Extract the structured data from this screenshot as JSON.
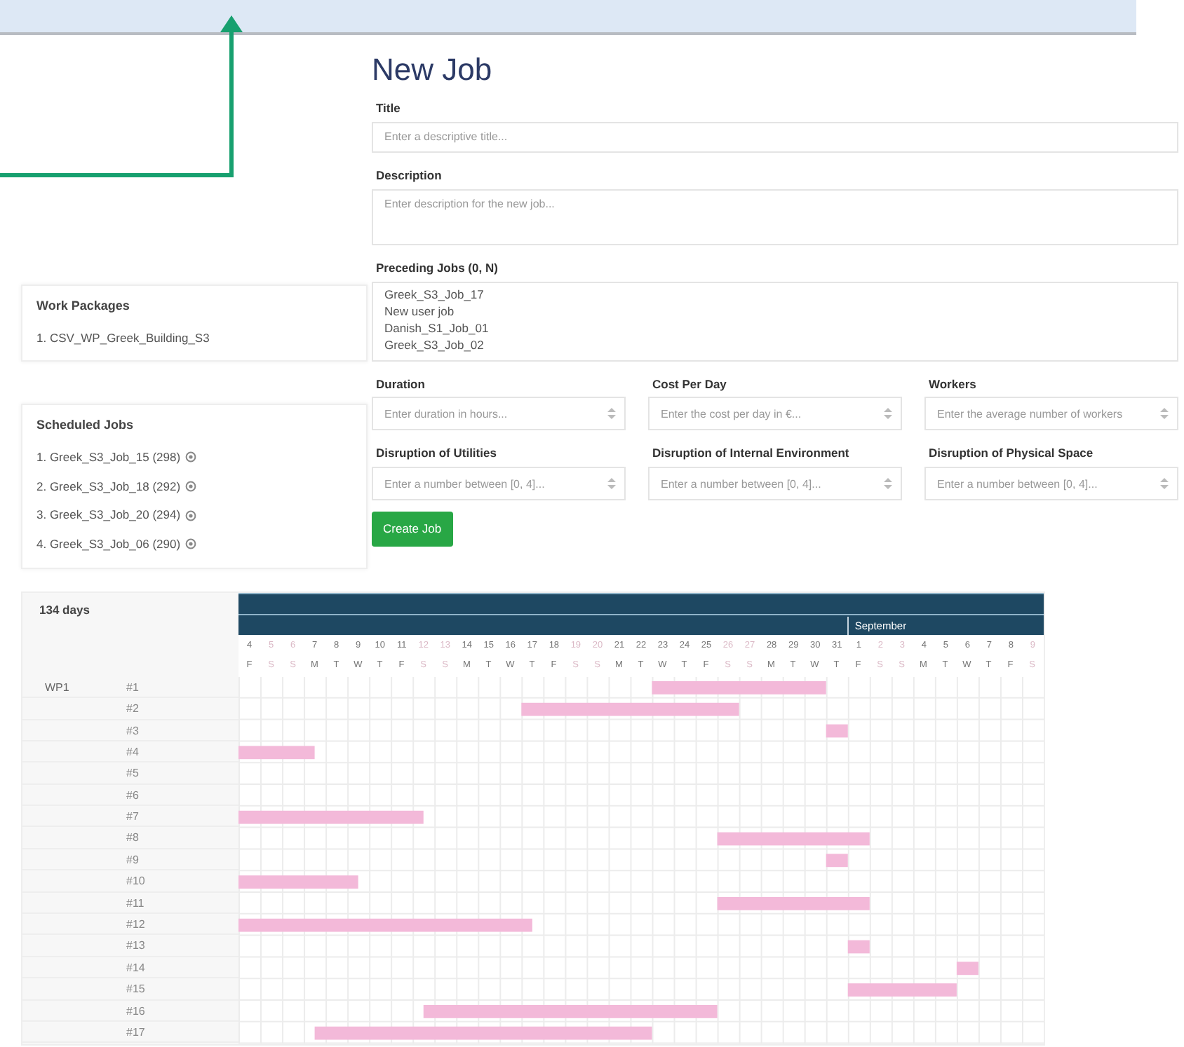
{
  "form": {
    "heading": "New Job",
    "fields": [
      {
        "kind": "text",
        "label": "Title",
        "placeholder": "Enter a descriptive title..."
      },
      {
        "kind": "textarea",
        "label": "Description",
        "placeholder": "Enter description for the new job..."
      },
      {
        "kind": "list",
        "label": "Preceding Jobs (0, N)",
        "options": [
          "Greek_S3_Job_17",
          "New user job",
          "Danish_S1_Job_01",
          "Greek_S3_Job_02"
        ]
      }
    ],
    "number_fields": [
      {
        "label": "Duration",
        "placeholder": "Enter duration in hours..."
      },
      {
        "label": "Cost Per Day",
        "placeholder": "Enter the cost per day in €..."
      },
      {
        "label": "Workers",
        "placeholder": "Enter the average number of workers"
      },
      {
        "label": "Disruption of Utilities",
        "placeholder": "Enter a number between [0, 4]..."
      },
      {
        "label": "Disruption of Internal Environment",
        "placeholder": "Enter a number between [0, 4]..."
      },
      {
        "label": "Disruption of Physical Space",
        "placeholder": "Enter a number between [0, 4]..."
      }
    ],
    "submit": "Create Job"
  },
  "work_packages": {
    "title": "Work Packages",
    "items": [
      "1. CSV_WP_Greek_Building_S3"
    ]
  },
  "scheduled_jobs": {
    "title": "Scheduled Jobs",
    "items": [
      "1. Greek_S3_Job_15 (298)",
      "2. Greek_S3_Job_18 (292)",
      "3. Greek_S3_Job_20 (294)",
      "4. Greek_S3_Job_06 (290)"
    ]
  },
  "gantt": {
    "total": "134 days",
    "group": "WP1",
    "days": [
      {
        "date": "4",
        "weekday": "F",
        "weekend": false
      },
      {
        "date": "5",
        "weekday": "S",
        "weekend": true
      },
      {
        "date": "6",
        "weekday": "S",
        "weekend": true
      },
      {
        "date": "7",
        "weekday": "M",
        "weekend": false
      },
      {
        "date": "8",
        "weekday": "T",
        "weekend": false
      },
      {
        "date": "9",
        "weekday": "W",
        "weekend": false
      },
      {
        "date": "10",
        "weekday": "T",
        "weekend": false
      },
      {
        "date": "11",
        "weekday": "F",
        "weekend": false
      },
      {
        "date": "12",
        "weekday": "S",
        "weekend": true
      },
      {
        "date": "13",
        "weekday": "S",
        "weekend": true
      },
      {
        "date": "14",
        "weekday": "M",
        "weekend": false
      },
      {
        "date": "15",
        "weekday": "T",
        "weekend": false
      },
      {
        "date": "16",
        "weekday": "W",
        "weekend": false
      },
      {
        "date": "17",
        "weekday": "T",
        "weekend": false
      },
      {
        "date": "18",
        "weekday": "F",
        "weekend": false
      },
      {
        "date": "19",
        "weekday": "S",
        "weekend": true
      },
      {
        "date": "20",
        "weekday": "S",
        "weekend": true
      },
      {
        "date": "21",
        "weekday": "M",
        "weekend": false
      },
      {
        "date": "22",
        "weekday": "T",
        "weekend": false
      },
      {
        "date": "23",
        "weekday": "W",
        "weekend": false
      },
      {
        "date": "24",
        "weekday": "T",
        "weekend": false
      },
      {
        "date": "25",
        "weekday": "F",
        "weekend": false
      },
      {
        "date": "26",
        "weekday": "S",
        "weekend": true
      },
      {
        "date": "27",
        "weekday": "S",
        "weekend": true
      },
      {
        "date": "28",
        "weekday": "M",
        "weekend": false
      },
      {
        "date": "29",
        "weekday": "T",
        "weekend": false
      },
      {
        "date": "30",
        "weekday": "W",
        "weekend": false
      },
      {
        "date": "31",
        "weekday": "T",
        "weekend": false
      },
      {
        "date": "1",
        "weekday": "F",
        "weekend": false,
        "month": "September"
      },
      {
        "date": "2",
        "weekday": "S",
        "weekend": true
      },
      {
        "date": "3",
        "weekday": "S",
        "weekend": true
      },
      {
        "date": "4",
        "weekday": "M",
        "weekend": false
      },
      {
        "date": "5",
        "weekday": "T",
        "weekend": false
      },
      {
        "date": "6",
        "weekday": "W",
        "weekend": false
      },
      {
        "date": "7",
        "weekday": "T",
        "weekend": false
      },
      {
        "date": "8",
        "weekday": "F",
        "weekend": false
      },
      {
        "date": "9",
        "weekday": "S",
        "weekend": true
      }
    ],
    "rows": [
      "#1",
      "#2",
      "#3",
      "#4",
      "#5",
      "#6",
      "#7",
      "#8",
      "#9",
      "#10",
      "#11",
      "#12",
      "#13",
      "#14",
      "#15",
      "#16",
      "#17"
    ]
  }
}
